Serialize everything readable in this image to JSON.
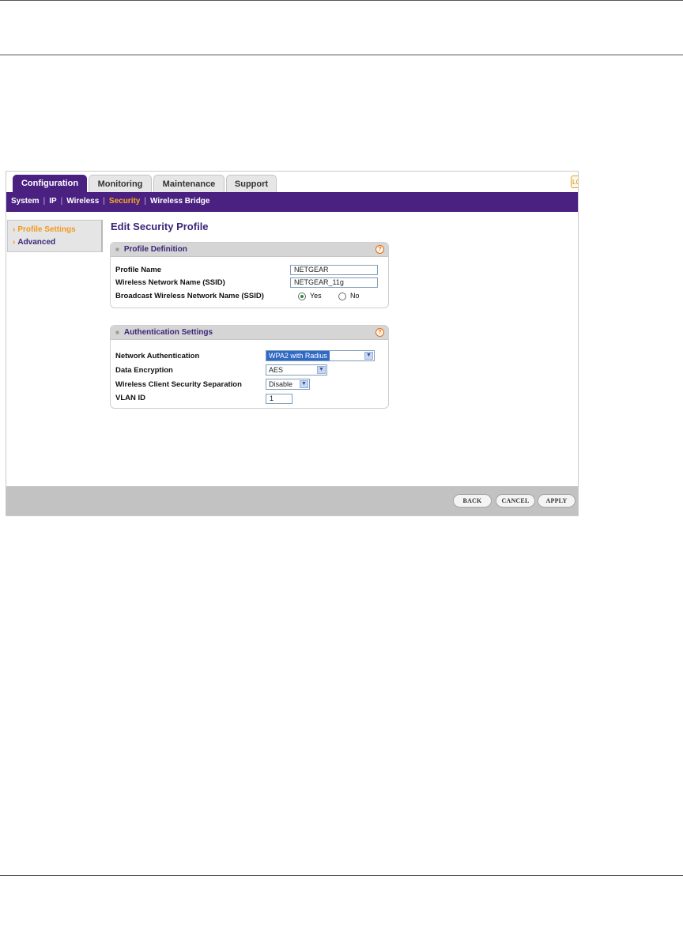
{
  "tabs": [
    {
      "label": "Configuration",
      "active": true
    },
    {
      "label": "Monitoring",
      "active": false
    },
    {
      "label": "Maintenance",
      "active": false
    },
    {
      "label": "Support",
      "active": false
    }
  ],
  "logout_stub": "LO",
  "subnav": {
    "items": [
      "System",
      "IP",
      "Wireless",
      "Security",
      "Wireless Bridge"
    ],
    "separator": "|",
    "current": "Security"
  },
  "sidebar": {
    "items": [
      {
        "label": "Profile Settings",
        "current": true
      },
      {
        "label": "Advanced",
        "current": false
      }
    ],
    "arrow": "›"
  },
  "page_title": "Edit Security Profile",
  "profile_definition": {
    "title": "Profile Definition",
    "help": "?",
    "profile_name_label": "Profile Name",
    "profile_name_value": "NETGEAR",
    "ssid_label": "Wireless Network Name (SSID)",
    "ssid_value": "NETGEAR_11g",
    "broadcast_label": "Broadcast Wireless Network Name (SSID)",
    "broadcast_yes": "Yes",
    "broadcast_no": "No",
    "broadcast_selected": "Yes"
  },
  "authentication_settings": {
    "title": "Authentication Settings",
    "help": "?",
    "network_auth_label": "Network Authentication",
    "network_auth_value": "WPA2 with Radius",
    "data_encryption_label": "Data Encryption",
    "data_encryption_value": "AES",
    "client_separation_label": "Wireless Client Security Separation",
    "client_separation_value": "Disable",
    "vlan_label": "VLAN ID",
    "vlan_value": "1"
  },
  "buttons": {
    "back": "BACK",
    "cancel": "CANCEL",
    "apply": "APPLY"
  },
  "icons": {
    "dropdown": "▼",
    "panel_bullet": "■"
  },
  "colors": {
    "brand_purple": "#4a2181",
    "accent_orange": "#f29a1c"
  }
}
